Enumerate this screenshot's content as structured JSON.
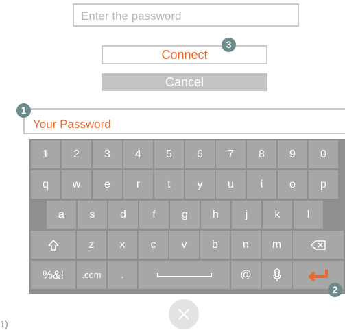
{
  "form": {
    "password_placeholder": "Enter the password",
    "connect_label": "Connect",
    "cancel_label": "Cancel"
  },
  "keyboard": {
    "title": "Your Password",
    "rows": [
      [
        "1",
        "2",
        "3",
        "4",
        "5",
        "6",
        "7",
        "8",
        "9",
        "0"
      ],
      [
        "q",
        "w",
        "e",
        "r",
        "t",
        "y",
        "u",
        "i",
        "o",
        "p"
      ],
      [
        "a",
        "s",
        "d",
        "f",
        "g",
        "h",
        "j",
        "k",
        "l"
      ],
      [
        "shift-icon",
        "z",
        "x",
        "c",
        "v",
        "b",
        "n",
        "m",
        "backspace-icon"
      ],
      [
        "%&!",
        ".com",
        ".",
        "space",
        "@",
        "mic-icon",
        "enter-icon"
      ]
    ]
  },
  "badges": {
    "one": "1",
    "two": "2",
    "three": "3"
  },
  "footnote": "1)",
  "colors": {
    "accent": "#e8692e",
    "key": "#a7a7a7",
    "keyboard_bg": "#8f8f8f",
    "badge": "#6d8a8c"
  }
}
